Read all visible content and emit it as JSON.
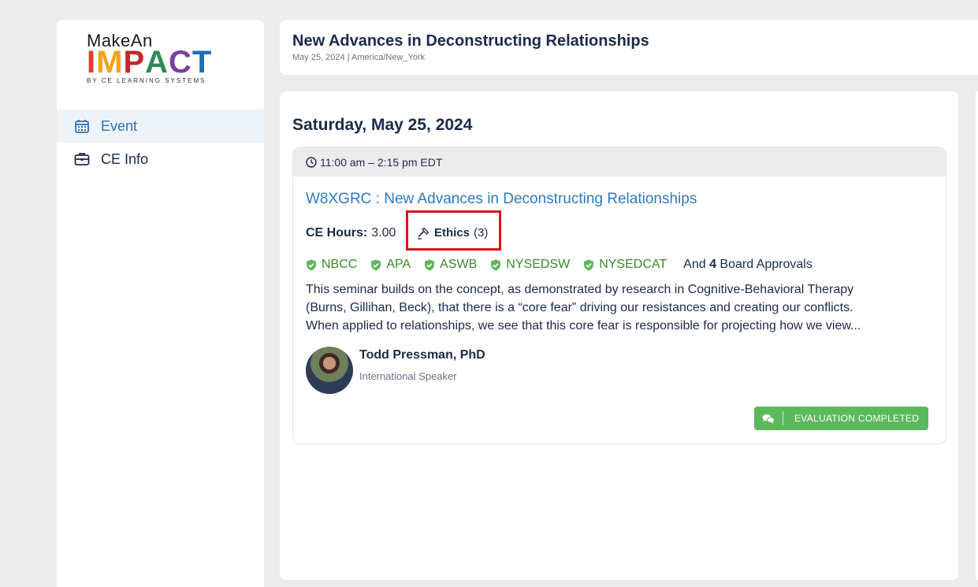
{
  "sidebar": {
    "logo": {
      "line1": "MakeAn",
      "line2_letters": [
        "I",
        "M",
        "P",
        "A",
        "C",
        "T"
      ],
      "line2_colors": [
        "#e63c2e",
        "#f2a41a",
        "#c1272d",
        "#2e8b57",
        "#7b3fa0",
        "#1f6fb2"
      ],
      "byline": "BY CE LEARNING SYSTEMS"
    },
    "items": [
      {
        "label": "Event",
        "icon": "calendar-icon",
        "active": true
      },
      {
        "label": "CE Info",
        "icon": "briefcase-icon",
        "active": false
      }
    ]
  },
  "header": {
    "title": "New Advances in Deconstructing Relationships",
    "subtitle": "May 25, 2024 | America/New_York"
  },
  "main": {
    "day_title": "Saturday, May 25, 2024",
    "session": {
      "time": "11:00 am – 2:15 pm EDT",
      "title": "W8XGRC : New Advances in Deconstructing Relationships",
      "ce_hours_label": "CE Hours:",
      "ce_hours_value": "3.00",
      "ethics_label": "Ethics",
      "ethics_count": "(3)",
      "boards": [
        "NBCC",
        "APA",
        "ASWB",
        "NYSEDSW",
        "NYSEDCAT"
      ],
      "and_text_pre": "And",
      "and_count": "4",
      "and_text_post": "Board Approvals",
      "description_lines": [
        "This seminar builds on the concept, as demonstrated by research in Cognitive-Behavioral Therapy",
        "(Burns, Gillihan, Beck), that there is a “core fear” driving our resistances and creating our conflicts.",
        "When applied to relationships, we see that this core fear is responsible for projecting how we view..."
      ],
      "speaker": {
        "name": "Todd Pressman, PhD",
        "role": "International Speaker"
      },
      "evaluation_label": "EVALUATION COMPLETED"
    }
  },
  "colors": {
    "accent_blue": "#2f7ac4",
    "navy": "#1c2a4a",
    "board_green": "#3b8a2a",
    "button_green": "#5cb85c",
    "highlight_red": "#d9141e"
  }
}
